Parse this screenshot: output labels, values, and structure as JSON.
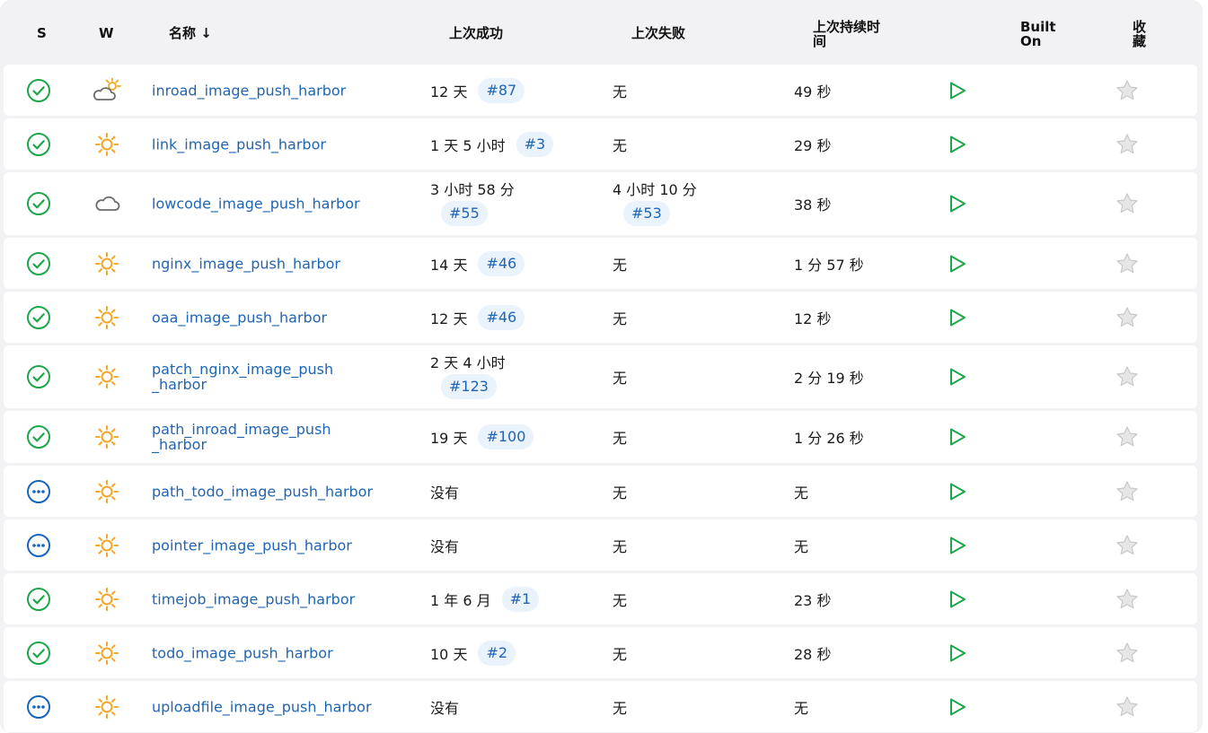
{
  "header": {
    "status": "S",
    "weather": "W",
    "name": "名称 ↓",
    "last_success": "上次成功",
    "last_failure": "上次失败",
    "last_duration_line1": "上次持续时",
    "last_duration_line2": "间",
    "built_on_line1": "Built",
    "built_on_line2": "On",
    "favorite_line1": "收",
    "favorite_line2": "藏"
  },
  "colors": {
    "link": "#1f65b4",
    "success": "#1ea64a",
    "in_progress": "#1565c0",
    "sun": "#f5a623",
    "cloud": "#6b6b6b",
    "play": "#1ea64a",
    "star": "#c8c8c8",
    "badge_bg": "#eaf2fb"
  },
  "jobs": [
    {
      "status": "success-icon",
      "weather": "sun-cloud-icon",
      "name_line1": "inroad_image_push_harbor",
      "name_line2": "",
      "success_time": "12 天",
      "success_build": "#87",
      "failure_time": "无",
      "failure_build": "",
      "duration": "49 秒"
    },
    {
      "status": "success-icon",
      "weather": "sun-icon",
      "name_line1": "link_image_push_harbor",
      "name_line2": "",
      "success_time": "1 天 5 小时",
      "success_build": "#3",
      "failure_time": "无",
      "failure_build": "",
      "duration": "29 秒"
    },
    {
      "status": "success-icon",
      "weather": "cloud-icon",
      "name_line1": "lowcode_image_push_harbor",
      "name_line2": "",
      "success_time": "3 小时 58 分",
      "success_build": "#55",
      "failure_time": "4 小时 10 分",
      "failure_build": "#53",
      "duration": "38 秒"
    },
    {
      "status": "success-icon",
      "weather": "sun-icon",
      "name_line1": "nginx_image_push_harbor",
      "name_line2": "",
      "success_time": "14 天",
      "success_build": "#46",
      "failure_time": "无",
      "failure_build": "",
      "duration": "1 分 57 秒"
    },
    {
      "status": "success-icon",
      "weather": "sun-icon",
      "name_line1": "oaa_image_push_harbor",
      "name_line2": "",
      "success_time": "12 天",
      "success_build": "#46",
      "failure_time": "无",
      "failure_build": "",
      "duration": "12 秒"
    },
    {
      "status": "success-icon",
      "weather": "sun-icon",
      "name_line1": "patch_nginx_image_push",
      "name_line2": "_harbor",
      "success_time": "2 天 4 小时",
      "success_build": "#123",
      "failure_time": "无",
      "failure_build": "",
      "duration": "2 分 19 秒"
    },
    {
      "status": "success-icon",
      "weather": "sun-icon",
      "name_line1": "path_inroad_image_push",
      "name_line2": "_harbor",
      "success_time": "19 天",
      "success_build": "#100",
      "failure_time": "无",
      "failure_build": "",
      "duration": "1 分 26 秒"
    },
    {
      "status": "in-progress-icon",
      "weather": "sun-icon",
      "name_line1": "path_todo_image_push_harbor",
      "name_line2": "",
      "success_time": "没有",
      "success_build": "",
      "failure_time": "无",
      "failure_build": "",
      "duration": "无"
    },
    {
      "status": "in-progress-icon",
      "weather": "sun-icon",
      "name_line1": "pointer_image_push_harbor",
      "name_line2": "",
      "success_time": "没有",
      "success_build": "",
      "failure_time": "无",
      "failure_build": "",
      "duration": "无"
    },
    {
      "status": "success-icon",
      "weather": "sun-icon",
      "name_line1": "timejob_image_push_harbor",
      "name_line2": "",
      "success_time": "1 年 6 月",
      "success_build": "#1",
      "failure_time": "无",
      "failure_build": "",
      "duration": "23 秒"
    },
    {
      "status": "success-icon",
      "weather": "sun-icon",
      "name_line1": "todo_image_push_harbor",
      "name_line2": "",
      "success_time": "10 天",
      "success_build": "#2",
      "failure_time": "无",
      "failure_build": "",
      "duration": "28 秒"
    },
    {
      "status": "in-progress-icon",
      "weather": "sun-icon",
      "name_line1": "uploadfile_image_push_harbor",
      "name_line2": "",
      "success_time": "没有",
      "success_build": "",
      "failure_time": "无",
      "failure_build": "",
      "duration": "无"
    }
  ]
}
